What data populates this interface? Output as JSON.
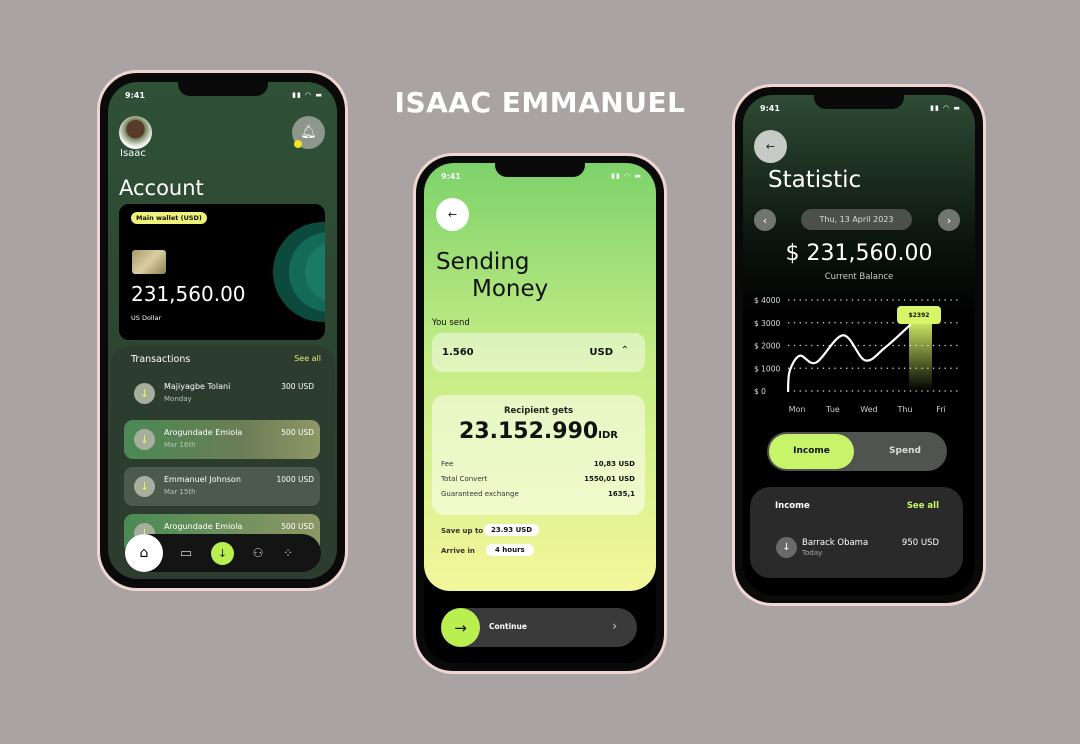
{
  "designer": "ISAAC EMMANUEL",
  "status_time": "9:41",
  "account": {
    "user_name": "Isaac",
    "heading": "Account",
    "wallet_badge": "Main wallet (USD)",
    "balance": "231,560.00",
    "currency": "US Dollar",
    "transactions_title": "Transactions",
    "see_all": "See all",
    "transactions": [
      {
        "name": "Majiyagbe Tolani",
        "date": "Monday",
        "amount": "300 USD"
      },
      {
        "name": "Arogundade Emiola",
        "date": "Mar 16th",
        "amount": "500 USD"
      },
      {
        "name": "Emmanuel Johnson",
        "date": "Mar 15th",
        "amount": "1000 USD"
      },
      {
        "name": "Arogundade Emiola",
        "date": "",
        "amount": "500 USD"
      }
    ],
    "nav": [
      "home-icon",
      "card-icon",
      "receive-icon",
      "contacts-icon",
      "apps-icon"
    ]
  },
  "sending": {
    "title_line1": "Sending",
    "title_line2": "Money",
    "you_send_label": "You send",
    "you_send_value": "1.560",
    "you_send_currency": "USD",
    "recipient_label": "Recipient gets",
    "recipient_amount": "23.152.990",
    "recipient_currency": "IDR",
    "details": [
      {
        "label": "Fee",
        "value": "10,83 USD"
      },
      {
        "label": "Total Convert",
        "value": "1550,01 USD"
      },
      {
        "label": "Guaranteed exchange",
        "value": "1635,1"
      }
    ],
    "save_label": "Save up to",
    "save_value": "23.93 USD",
    "arrive_label": "Arrive in",
    "arrive_value": "4 hours",
    "continue_label": "Continue"
  },
  "statistic": {
    "title": "Statistic",
    "date": "Thu, 13 April 2023",
    "balance": "$ 231,560.00",
    "balance_label": "Current Balance",
    "toggle": {
      "income": "Income",
      "spend": "Spend",
      "selected": "Income"
    },
    "panel_title": "Income",
    "see_all": "See all",
    "income_item": {
      "name": "Barrack Obama",
      "date": "Today",
      "amount": "950 USD"
    }
  },
  "chart_data": {
    "type": "line",
    "y_ticks": [
      "$ 4000",
      "$ 3000",
      "$ 2000",
      "$ 1000",
      "$ 0"
    ],
    "ylim": [
      0,
      4000
    ],
    "categories": [
      "Mon",
      "Tue",
      "Wed",
      "Thu",
      "Fri"
    ],
    "x": [
      -0.25,
      -0.2,
      0.08,
      0.53,
      1.28,
      1.89,
      2.44,
      3.14
    ],
    "y": [
      0,
      900,
      1550,
      1250,
      2450,
      1350,
      1900,
      2900
    ],
    "highlight": {
      "category": "Thu",
      "label": "$2392"
    },
    "grid": "dotted horizontal",
    "colors": {
      "line": "#ffffff",
      "highlight": "#d8f56a"
    }
  }
}
